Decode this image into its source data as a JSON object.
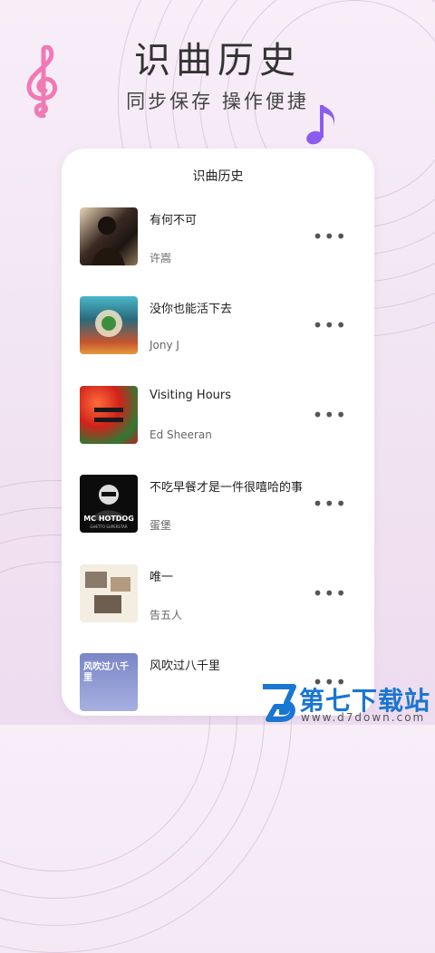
{
  "header": {
    "title": "识曲历史",
    "subtitle": "同步保存 操作便捷"
  },
  "card": {
    "title": "识曲历史",
    "more_icon": "more-horizontal-icon",
    "songs": [
      {
        "name": "有何不可",
        "artist": "许嵩"
      },
      {
        "name": "没你也能活下去",
        "artist": "Jony J"
      },
      {
        "name": "Visiting Hours",
        "artist": "Ed Sheeran"
      },
      {
        "name": "不吃早餐才是一件很嘻哈的事",
        "artist": "蛋堡",
        "cover_text": "MC HOTDOG",
        "cover_subtext": "GHETTO SUPERSTAR"
      },
      {
        "name": "唯一",
        "artist": "告五人"
      },
      {
        "name": "风吹过八千里",
        "artist": "",
        "cover_text": "风吹过八千里"
      }
    ]
  },
  "watermark": {
    "name": "第七下载站",
    "url": "www.d7down.com"
  },
  "colors": {
    "background": "#f3e6f3",
    "clef": "#f07ab4",
    "note": "#8a5cf0",
    "watermark": "#1976d2"
  }
}
